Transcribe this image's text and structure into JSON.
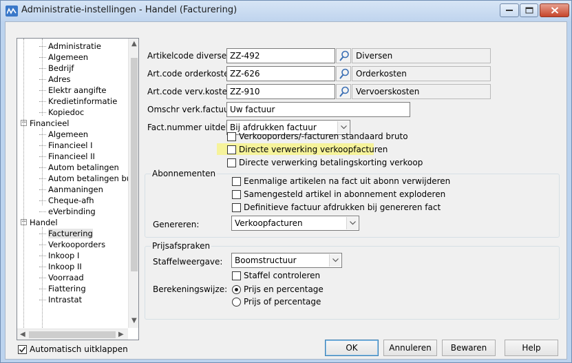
{
  "window": {
    "title": "Administratie-instellingen - Handel (Facturering)"
  },
  "tree": {
    "items": [
      {
        "label": "Administratie"
      },
      {
        "label": "Algemeen"
      },
      {
        "label": "Bedrijf"
      },
      {
        "label": "Adres"
      },
      {
        "label": "Elektr aangifte"
      },
      {
        "label": "Kredietinformatie"
      },
      {
        "label": "Kopiedoc"
      },
      {
        "label": "Financieel",
        "expander": "−"
      },
      {
        "label": "Algemeen"
      },
      {
        "label": "Financieel I"
      },
      {
        "label": "Financieel II"
      },
      {
        "label": "Autom betalingen"
      },
      {
        "label": "Autom betalingen bui"
      },
      {
        "label": "Aanmaningen"
      },
      {
        "label": "Cheque-afh"
      },
      {
        "label": "eVerbinding"
      },
      {
        "label": "Handel",
        "expander": "−"
      },
      {
        "label": "Facturering",
        "selected": true
      },
      {
        "label": "Verkooporders"
      },
      {
        "label": "Inkoop I"
      },
      {
        "label": "Inkoop II"
      },
      {
        "label": "Voorraad"
      },
      {
        "label": "Fiattering"
      },
      {
        "label": "Intrastat"
      }
    ]
  },
  "auto_expand": {
    "label": "Automatisch uitklappen",
    "checked": true
  },
  "form": {
    "artikelcode_diversen": {
      "label": "Artikelcode diversen:",
      "value": "ZZ-492",
      "description": "Diversen"
    },
    "art_code_orderkosten": {
      "label": "Art.code orderkosten:",
      "value": "ZZ-626",
      "description": "Orderkosten"
    },
    "art_code_verv_kosten": {
      "label": "Art.code verv.kosten:",
      "value": "ZZ-910",
      "description": "Vervoerskosten"
    },
    "omschr_verk_factuur": {
      "label": "Omschr verk.factuur:",
      "value": "Uw factuur"
    },
    "fact_nummer_uitdelen": {
      "label": "Fact.nummer uitdelen:",
      "value": "Bij afdrukken factuur"
    },
    "checkboxes": [
      {
        "label": "Verkooporders/-facturen standaard bruto",
        "checked": false
      },
      {
        "label": "Directe verwerking verkoopfacturen",
        "checked": false,
        "highlighted": true
      },
      {
        "label": "Directe verwerking betalingskorting verkoop",
        "checked": false
      }
    ]
  },
  "abonnementen": {
    "title": "Abonnementen",
    "checkboxes": [
      {
        "label": "Eenmalige artikelen na fact uit abonn verwijderen",
        "checked": false
      },
      {
        "label": "Samengesteld artikel in abonnement exploderen",
        "checked": false
      },
      {
        "label": "Definitieve factuur afdrukken bij genereren fact",
        "checked": false
      }
    ],
    "genereren": {
      "label": "Genereren:",
      "value": "Verkoopfacturen"
    }
  },
  "prijsafspraken": {
    "title": "Prijsafspraken",
    "staffelweergave": {
      "label": "Staffelweergave:",
      "value": "Boomstructuur"
    },
    "staffel_controleren": {
      "label": "Staffel controleren",
      "checked": false
    },
    "berekeningswijze": {
      "label": "Berekeningswijze:",
      "options": [
        {
          "label": "Prijs en percentage",
          "selected": true
        },
        {
          "label": "Prijs of percentage",
          "selected": false
        }
      ]
    }
  },
  "buttons": {
    "ok": "OK",
    "annuleren": "Annuleren",
    "bewaren": "Bewaren",
    "help": "Help"
  },
  "colors": {
    "titlebar": "#bfd4ee",
    "highlight": "#f6f39b",
    "close": "#c6452b"
  }
}
